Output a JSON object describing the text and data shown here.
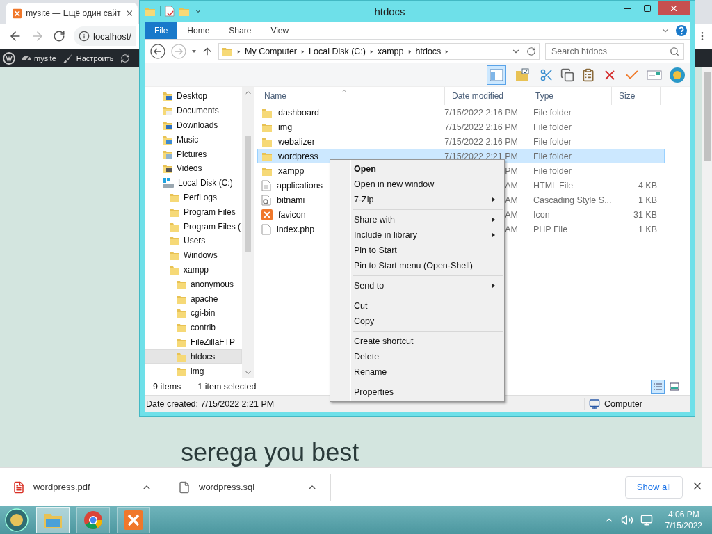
{
  "browser": {
    "tab": {
      "title": "mysite — Ещё один сайт"
    },
    "address": "localhost/",
    "admin_bar": [
      {
        "kind": "logo"
      },
      {
        "kind": "site",
        "label": "mysite"
      },
      {
        "kind": "customize",
        "label": "Настроить"
      },
      {
        "kind": "updates"
      }
    ],
    "heading": "serega you best"
  },
  "explorer": {
    "title": "htdocs",
    "ribbon_tabs": [
      {
        "label": "File",
        "selected": true
      },
      {
        "label": "Home",
        "selected": false
      },
      {
        "label": "Share",
        "selected": false
      },
      {
        "label": "View",
        "selected": false
      }
    ],
    "breadcrumb": [
      "My Computer",
      "Local Disk (C:)",
      "xampp",
      "htdocs"
    ],
    "search": {
      "placeholder": "Search htdocs"
    },
    "nav_tree": [
      {
        "label": "Desktop",
        "kind": "desktop",
        "selected": false
      },
      {
        "label": "Documents",
        "kind": "documents",
        "selected": false
      },
      {
        "label": "Downloads",
        "kind": "downloads",
        "selected": false
      },
      {
        "label": "Music",
        "kind": "music",
        "selected": false
      },
      {
        "label": "Pictures",
        "kind": "pictures",
        "selected": false
      },
      {
        "label": "Videos",
        "kind": "videos",
        "selected": false
      },
      {
        "label": "Local Disk (C:)",
        "kind": "drive",
        "selected": false,
        "children": [
          {
            "label": "PerfLogs",
            "selected": false
          },
          {
            "label": "Program Files",
            "selected": false
          },
          {
            "label": "Program Files (",
            "selected": false
          },
          {
            "label": "Users",
            "selected": false
          },
          {
            "label": "Windows",
            "selected": false
          },
          {
            "label": "xampp",
            "selected": false,
            "children": [
              {
                "label": "anonymous",
                "selected": false
              },
              {
                "label": "apache",
                "selected": false
              },
              {
                "label": "cgi-bin",
                "selected": false
              },
              {
                "label": "contrib",
                "selected": false
              },
              {
                "label": "FileZillaFTP",
                "selected": false
              },
              {
                "label": "htdocs",
                "selected": true
              },
              {
                "label": "img",
                "selected": false
              }
            ]
          }
        ]
      }
    ],
    "columns": [
      "Name",
      "Date modified",
      "Type",
      "Size"
    ],
    "files": [
      {
        "name": "dashboard",
        "kind": "folder",
        "date": "7/15/2022 2:16 PM",
        "type": "File folder",
        "selected": false
      },
      {
        "name": "img",
        "kind": "folder",
        "date": "7/15/2022 2:16 PM",
        "type": "File folder",
        "selected": false
      },
      {
        "name": "webalizer",
        "kind": "folder",
        "date": "7/15/2022 2:16 PM",
        "type": "File folder",
        "selected": false
      },
      {
        "name": "wordpress",
        "kind": "folder",
        "date": "7/15/2022 2:21 PM",
        "type": "File folder",
        "selected": true
      },
      {
        "name": "xampp",
        "kind": "folder",
        "date": "PM",
        "type": "File folder",
        "selected": false
      },
      {
        "name": "applications",
        "kind": "html",
        "date": "AM",
        "type": "HTML File",
        "size": "4 KB",
        "selected": false
      },
      {
        "name": "bitnami",
        "kind": "css",
        "date": "AM",
        "type": "Cascading Style S...",
        "size": "1 KB",
        "selected": false
      },
      {
        "name": "favicon",
        "kind": "icon",
        "date": "AM",
        "type": "Icon",
        "size": "31 KB",
        "selected": false
      },
      {
        "name": "index.php",
        "kind": "php",
        "date": "AM",
        "type": "PHP File",
        "size": "1 KB",
        "selected": false
      }
    ],
    "status": {
      "count": "9 items",
      "selection": "1 item selected"
    },
    "details": "Date created: 7/15/2022 2:21 PM",
    "location": "Computer"
  },
  "context_menu": [
    [
      {
        "label": "Open",
        "default": true,
        "submenu": false
      },
      {
        "label": "Open in new window",
        "default": false,
        "submenu": false
      },
      {
        "label": "7-Zip",
        "default": false,
        "submenu": true
      }
    ],
    [
      {
        "label": "Share with",
        "default": false,
        "submenu": true
      },
      {
        "label": "Include in library",
        "default": false,
        "submenu": true
      },
      {
        "label": "Pin to Start",
        "default": false,
        "submenu": false
      },
      {
        "label": "Pin to Start menu (Open-Shell)",
        "default": false,
        "submenu": false
      }
    ],
    [
      {
        "label": "Send to",
        "default": false,
        "submenu": true
      }
    ],
    [
      {
        "label": "Cut",
        "default": false,
        "submenu": false
      },
      {
        "label": "Copy",
        "default": false,
        "submenu": false
      }
    ],
    [
      {
        "label": "Create shortcut",
        "default": false,
        "submenu": false
      },
      {
        "label": "Delete",
        "default": false,
        "submenu": false
      },
      {
        "label": "Rename",
        "default": false,
        "submenu": false
      }
    ],
    [
      {
        "label": "Properties",
        "default": false,
        "submenu": false
      }
    ]
  ],
  "downloads": [
    {
      "name": "wordpress.pdf",
      "kind": "pdf"
    },
    {
      "name": "wordpress.sql",
      "kind": "file"
    }
  ],
  "show_all": "Show all",
  "taskbar": {
    "apps": [
      {
        "kind": "explorer",
        "selected": true
      },
      {
        "kind": "chrome",
        "selected": false
      },
      {
        "kind": "xampp",
        "selected": false
      }
    ],
    "time": "4:06 PM",
    "date": "7/15/2022"
  }
}
